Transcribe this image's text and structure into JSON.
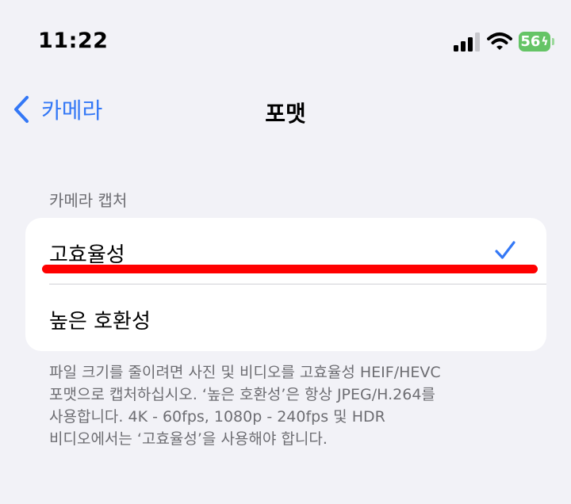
{
  "status_bar": {
    "time": "11:22",
    "battery_level": "56",
    "battery_color": "#65c466"
  },
  "nav": {
    "back_label": "카메라",
    "title": "포맷",
    "accent_color": "#3478f6"
  },
  "section": {
    "header": "카메라 캡처",
    "items": [
      {
        "label": "고효율성",
        "selected": true
      },
      {
        "label": "높은 호환성",
        "selected": false
      }
    ]
  },
  "footer": {
    "lines": [
      "파일 크기를 줄이려면 사진 및 비디오를 고효율성 HEIF/HEVC",
      "포맷으로 캡처하십시오. ‘높은 호환성’은 항상 JPEG/H.264를",
      "사용합니다. 4K - 60fps, 1080p - 240fps 및 HDR",
      "비디오에서는 ‘고효율성’을 사용해야 합니다."
    ]
  },
  "annotation": {
    "underline_color": "#ff0000"
  }
}
